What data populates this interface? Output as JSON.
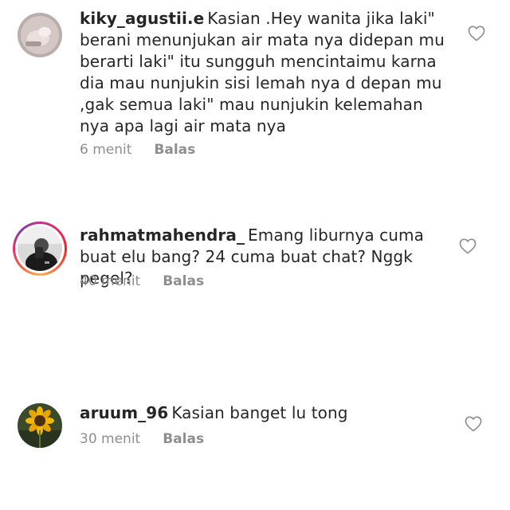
{
  "comments": [
    {
      "username": "kiky_agustii.e",
      "text": "Kasian .Hey wanita jika laki\" berani menunjukan air mata nya didepan mu berarti laki\" itu sungguh mencintaimu karna dia mau nunjukin sisi lemah nya d depan mu ,gak semua laki\" mau nunjukin kelemahan nya apa lagi air mata nya",
      "time": "6 menit",
      "reply_label": "Balas",
      "has_story_ring": false
    },
    {
      "username": "rahmatmahendra_",
      "text": "Emang liburnya cuma buat elu bang? 24 cuma buat chat? Nggk pegel?",
      "time": "40 menit",
      "reply_label": "Balas",
      "has_story_ring": true
    },
    {
      "username": "aruum_96",
      "text": "Kasian banget lu tong",
      "time": "30 menit",
      "reply_label": "Balas",
      "has_story_ring": false
    }
  ],
  "icons": {
    "like": "heart-outline-icon"
  },
  "colors": {
    "text": "#262626",
    "meta": "#8e8e8e",
    "background": "#ffffff"
  }
}
